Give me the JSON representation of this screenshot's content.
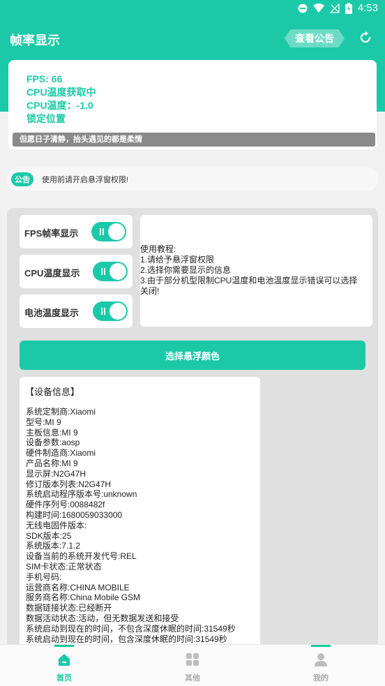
{
  "status_bar": {
    "time": "4:53"
  },
  "header": {
    "title": "帧率显示",
    "notice_button": "查看公告"
  },
  "fps_card": {
    "lines": [
      "FPS: 66",
      "CPU温度获取中",
      "CPU温度：-1.0",
      "锁定位置"
    ],
    "quote": "但愿日子清静，抬头遇见的都是柔情"
  },
  "notice": {
    "tag": "公告",
    "text": "使用前请开启悬浮窗权限!"
  },
  "toggles": [
    {
      "label": "FPS帧率显示",
      "on": true
    },
    {
      "label": "CPU温度显示",
      "on": true
    },
    {
      "label": "电池温度显示",
      "on": true
    }
  ],
  "tutorial": {
    "lines": [
      "使用教程:",
      "1.请给予悬浮窗权限",
      "2.选择你需要显示的信息",
      "3.由于部分机型限制CPU温度和电池温度显示错误可以选择",
      "关闭!"
    ]
  },
  "color_button": "选择悬浮颜色",
  "device_info": {
    "heading": "【设备信息】",
    "lines": [
      "系统定制商:Xiaomi",
      "型号:MI 9",
      "主板信息:MI 9",
      "设备参数:aosp",
      "硬件制造商:Xiaomi",
      "产品名称:MI 9",
      "显示屏:N2G47H",
      "修订版本列表:N2G47H",
      "系统启动程序版本号:unknown",
      "硬件序列号:0088482f",
      "构建时间:1680059033000",
      "无线电固件版本:",
      "SDK版本:25",
      "系统版本:7.1.2",
      "设备当前的系统开发代号:REL",
      "SIM卡状态:正常状态",
      "手机号码:",
      "运营商名称:CHINA MOBILE",
      "服务商名称:China Mobile GSM",
      "数据链接状态:已经断开",
      "数据活动状态:活动，但无数据发送和接受",
      "系统启动到现在的时间，不包含深度休眠的时间:31549秒",
      "系统启动到现在的时间，包含深度休眠的时间:31549秒"
    ]
  },
  "bottom_nav": [
    {
      "label": "首页",
      "active": true
    },
    {
      "label": "其他",
      "active": false
    },
    {
      "label": "我的",
      "active": false
    }
  ],
  "colors": {
    "accent": "#1bc9a8",
    "inactive": "#bdbdbd"
  }
}
